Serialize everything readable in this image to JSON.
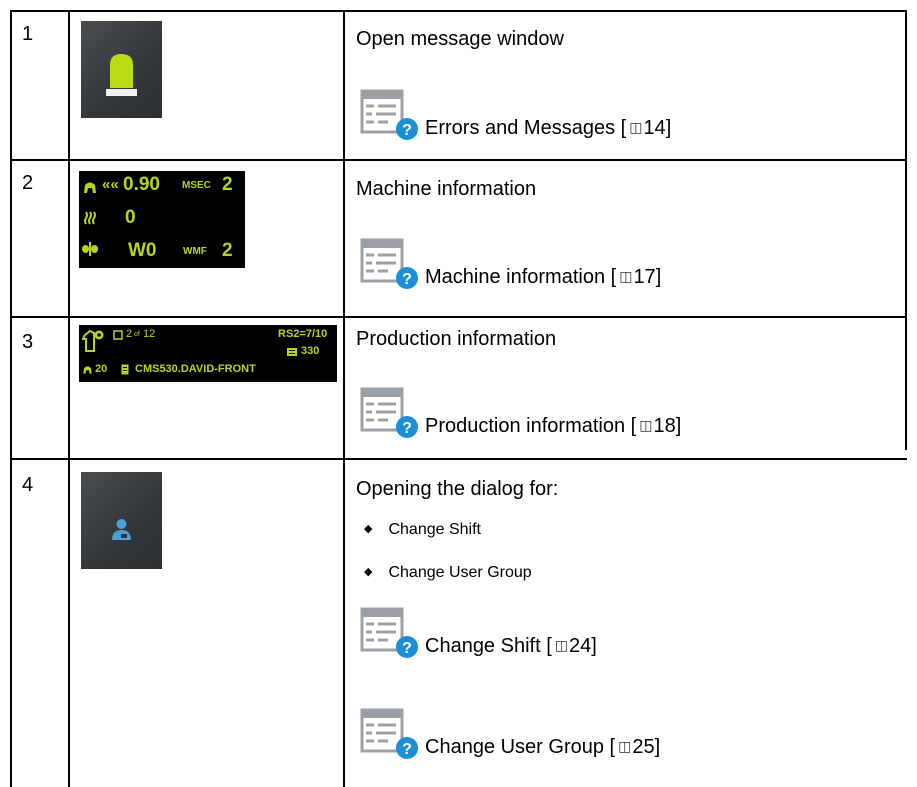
{
  "rows": [
    {
      "number": "1",
      "heading": "Open message window",
      "refs": [
        {
          "label": "Errors and Messages [",
          "page": "14",
          "close": "]"
        }
      ]
    },
    {
      "number": "2",
      "heading": "Machine information",
      "panel": {
        "speed": "0.90",
        "speed_unit": "MSEC",
        "speed_level": "2",
        "count": "0",
        "wmf_value": "W0",
        "wmf_unit": "WMF",
        "wmf_level": "2"
      },
      "refs": [
        {
          "label": "Machine information [",
          "page": "17",
          "close": "]"
        }
      ]
    },
    {
      "number": "3",
      "heading": "Production information",
      "panel": {
        "pieces": "2",
        "pieces_of": "of",
        "pieces_total": "12",
        "rs": "RS2=7/10",
        "count": "330",
        "yarn_count": "20",
        "program": "CMS530.DAVID-FRONT"
      },
      "refs": [
        {
          "label": "Production information [",
          "page": "18",
          "close": "]"
        }
      ]
    },
    {
      "number": "4",
      "heading": "Opening the dialog for:",
      "bullets": [
        "Change Shift",
        "Change User Group"
      ],
      "refs": [
        {
          "label": "Change Shift [",
          "page": "24",
          "close": "]"
        },
        {
          "label": "Change User Group [",
          "page": "25",
          "close": "]"
        }
      ]
    }
  ],
  "colors": {
    "status_light": "#b9dc14",
    "panel_text": "#b4d41e",
    "user_icon": "#4a9fd4",
    "help_badge": "#1a8fd8"
  },
  "icons": {
    "reference": "document-with-help-badge-icon",
    "status": "status-light-icon",
    "user": "user-icon"
  }
}
